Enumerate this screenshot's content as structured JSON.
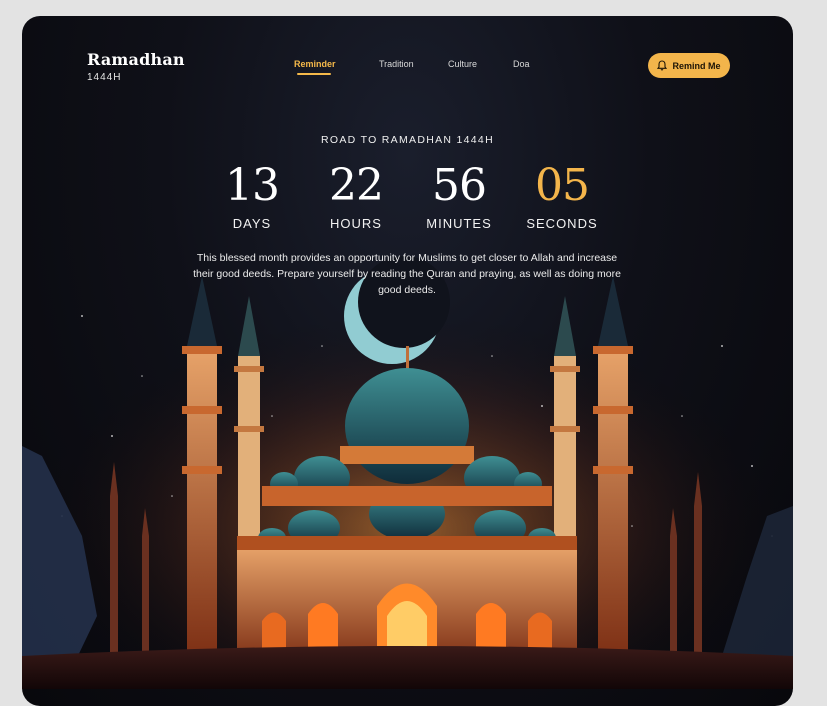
{
  "brand": {
    "title": "Ramadhan",
    "subtitle": "1444H"
  },
  "nav": {
    "items": [
      "Reminder",
      "Tradition",
      "Culture",
      "Doa"
    ],
    "active": "Reminder"
  },
  "remind_button": {
    "label": "Remind Me",
    "icon": "bell-icon"
  },
  "headline": "ROAD TO RAMADHAN 1444H",
  "countdown": [
    {
      "value": "13",
      "label": "DAYS"
    },
    {
      "value": "22",
      "label": "HOURS"
    },
    {
      "value": "56",
      "label": "MINUTES"
    },
    {
      "value": "05",
      "label": "SECONDS"
    }
  ],
  "description": "This blessed month provides an opportunity for Muslims to get closer to Allah and increase their good deeds. Prepare yourself by reading the Quran and praying, as well as doing more good deeds.",
  "colors": {
    "accent": "#f3b54b",
    "background": "#0f1018",
    "page": "#e3e3e3"
  }
}
